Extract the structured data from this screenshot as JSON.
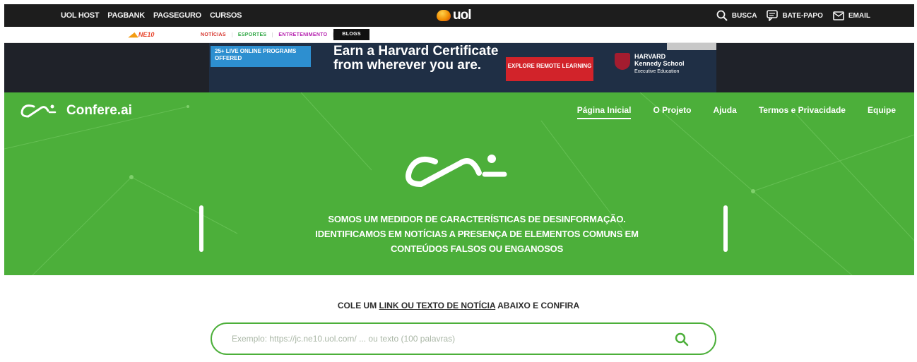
{
  "uol": {
    "left_links": [
      "UOL HOST",
      "PAGBANK",
      "PAGSEGURO",
      "CURSOS"
    ],
    "logo_text": "uol",
    "right_links": {
      "search": "BUSCA",
      "chat": "BATE-PAPO",
      "email": "EMAIL"
    }
  },
  "channels": {
    "ne10": "NE10",
    "items": [
      "NOTÍCIAS",
      "ESPORTES",
      "ENTRETENIMENTO",
      "BLOGS"
    ]
  },
  "ad": {
    "badge": "25+ LIVE ONLINE PROGRAMS OFFERED",
    "headline": "Earn a Harvard Certificate from wherever you are.",
    "cta": "EXPLORE REMOTE LEARNING",
    "school_line1": "HARVARD",
    "school_line2": "Kennedy School",
    "school_line3": "Executive Education"
  },
  "site": {
    "brand": "Confere.ai",
    "nav": [
      "Página Inicial",
      "O Projeto",
      "Ajuda",
      "Termos e Privacidade",
      "Equipe"
    ],
    "active_nav": "Página Inicial",
    "hero_line1": "SOMOS UM MEDIDOR DE CARACTERÍSTICAS DE DESINFORMAÇÃO.",
    "hero_line2": "IDENTIFICAMOS EM NOTÍCIAS A PRESENÇA DE ELEMENTOS COMUNS EM",
    "hero_line3": "CONTEÚDOS FALSOS OU ENGANOSOS",
    "accent": "#4caf3a"
  },
  "search": {
    "cta_prefix": "COLE UM ",
    "cta_link": "LINK OU TEXTO DE NOTÍCIA",
    "cta_suffix": " ABAIXO E CONFIRA",
    "placeholder": "Exemplo: https://jc.ne10.uol.com/ ... ou texto (100 palavras)",
    "value": "",
    "icon": "search-icon"
  }
}
